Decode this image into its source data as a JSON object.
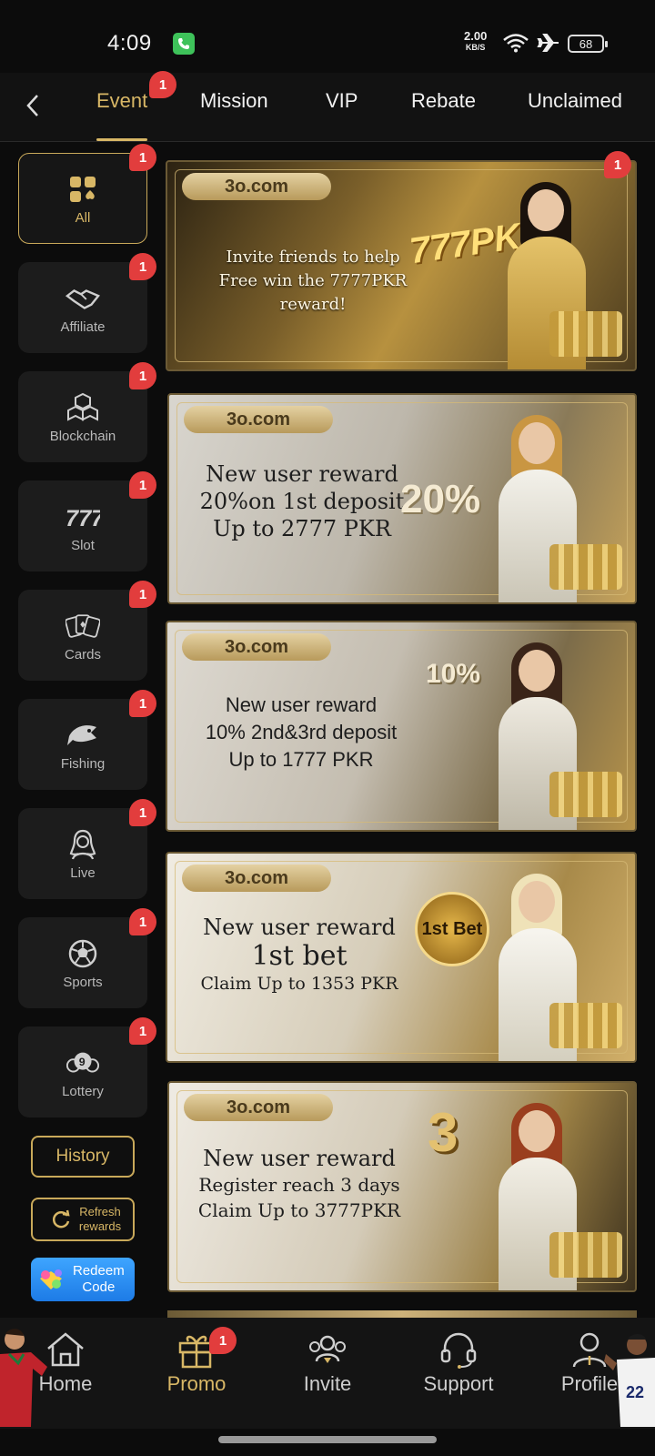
{
  "status_bar": {
    "time": "4:09",
    "net_speed": "2.00",
    "net_unit": "KB/S",
    "battery": "68"
  },
  "top_nav": {
    "tabs": [
      {
        "label": "Event",
        "badge": "1",
        "active": true
      },
      {
        "label": "Mission"
      },
      {
        "label": "VIP"
      },
      {
        "label": "Rebate"
      },
      {
        "label": "Unclaimed"
      }
    ]
  },
  "sidebar": {
    "items": [
      {
        "label": "All",
        "badge": "1",
        "active": true,
        "icon": "grid-spade-icon"
      },
      {
        "label": "Affiliate",
        "badge": "1",
        "icon": "handshake-icon"
      },
      {
        "label": "Blockchain",
        "badge": "1",
        "icon": "cubes-icon"
      },
      {
        "label": "Slot",
        "badge": "1",
        "icon": "777-icon"
      },
      {
        "label": "Cards",
        "badge": "1",
        "icon": "cards-icon"
      },
      {
        "label": "Fishing",
        "badge": "1",
        "icon": "fish-icon"
      },
      {
        "label": "Live",
        "badge": "1",
        "icon": "dealer-icon"
      },
      {
        "label": "Sports",
        "badge": "1",
        "icon": "soccer-ball-icon"
      },
      {
        "label": "Lottery",
        "badge": "1",
        "icon": "lottery-ball-icon"
      }
    ],
    "history_label": "History",
    "refresh_label_1": "Refresh",
    "refresh_label_2": "rewards",
    "redeem_label_1": "Redeem",
    "redeem_label_2": "Code"
  },
  "banners": [
    {
      "brand": "3o.com",
      "badge": "1",
      "line1": "Invite friends to help",
      "line2": "Free win the 7777PKR reward!",
      "line3": "",
      "amount": "777PKR"
    },
    {
      "brand": "3o.com",
      "line1": "New user reward",
      "line2": "20%on 1st deposit",
      "line3": "Up to 2777 PKR",
      "amount": "20%"
    },
    {
      "brand": "3o.com",
      "line1": "New user reward",
      "line2": "10% 2nd&3rd deposit",
      "line3": "Up to 1777 PKR",
      "amount": "10%"
    },
    {
      "brand": "3o.com",
      "line1": "New user reward",
      "line2": "1st bet",
      "line3": "Claim Up to 1353 PKR",
      "amount": "1st Bet"
    },
    {
      "brand": "3o.com",
      "line1": "New user reward",
      "line2": "Register reach 3 days",
      "line3": "Claim Up to 3777PKR",
      "amount": "3"
    }
  ],
  "bottom_nav": {
    "items": [
      {
        "label": "Home",
        "icon": "home-icon"
      },
      {
        "label": "Promo",
        "icon": "gift-icon",
        "badge": "1",
        "active": true
      },
      {
        "label": "Invite",
        "icon": "invite-icon"
      },
      {
        "label": "Support",
        "icon": "headset-icon"
      },
      {
        "label": "Profile",
        "icon": "profile-icon"
      }
    ]
  },
  "colors": {
    "accent_gold": "#d8b766",
    "badge_red": "#e23d3d",
    "background": "#0c0c0c",
    "redeem_blue": "#2b8ff2"
  }
}
